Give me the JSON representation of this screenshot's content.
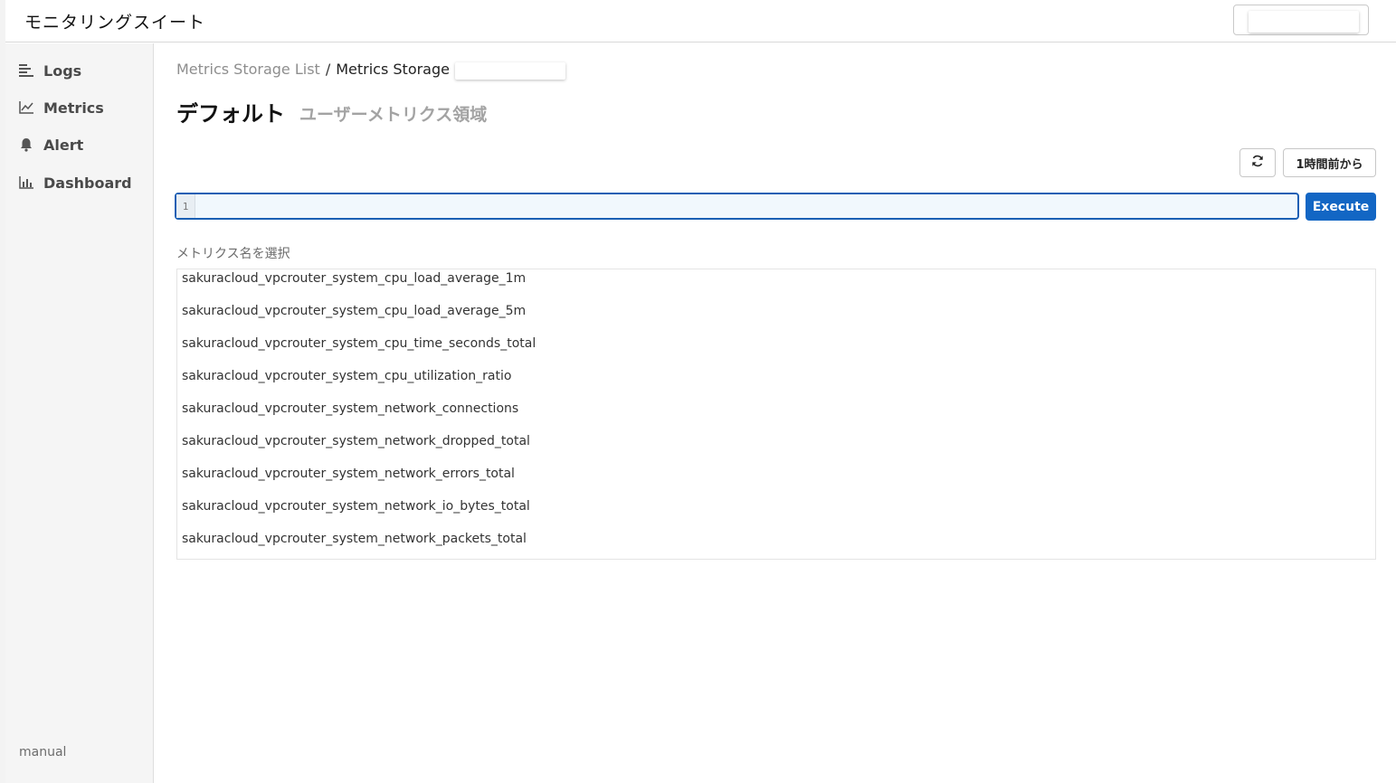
{
  "app": {
    "title": "モニタリングスイート"
  },
  "sidebar": {
    "items": [
      {
        "label": "Logs",
        "icon": "logs-icon"
      },
      {
        "label": "Metrics",
        "icon": "metrics-icon"
      },
      {
        "label": "Alert",
        "icon": "bell-icon"
      },
      {
        "label": "Dashboard",
        "icon": "dashboard-icon"
      }
    ],
    "footer": "manual"
  },
  "breadcrumb": {
    "link": "Metrics Storage List",
    "separator": "/",
    "current": "Metrics Storage"
  },
  "page": {
    "title": "デフォルト",
    "subtitle": "ユーザーメトリクス領域"
  },
  "toolbar": {
    "refresh_icon": "refresh-icon",
    "time_range": "1時間前から"
  },
  "query": {
    "line_number": "1",
    "value": "",
    "execute_label": "Execute"
  },
  "metrics": {
    "label": "メトリクス名を選択",
    "items": [
      "sakuracloud_vpcrouter_system_cpu_load_average_1m",
      "sakuracloud_vpcrouter_system_cpu_load_average_5m",
      "sakuracloud_vpcrouter_system_cpu_time_seconds_total",
      "sakuracloud_vpcrouter_system_cpu_utilization_ratio",
      "sakuracloud_vpcrouter_system_network_connections",
      "sakuracloud_vpcrouter_system_network_dropped_total",
      "sakuracloud_vpcrouter_system_network_errors_total",
      "sakuracloud_vpcrouter_system_network_io_bytes_total",
      "sakuracloud_vpcrouter_system_network_packets_total"
    ]
  },
  "colors": {
    "accent": "#1266c4",
    "editor_border": "#1a5fb4",
    "sidebar_bg": "#f5f5f5"
  }
}
